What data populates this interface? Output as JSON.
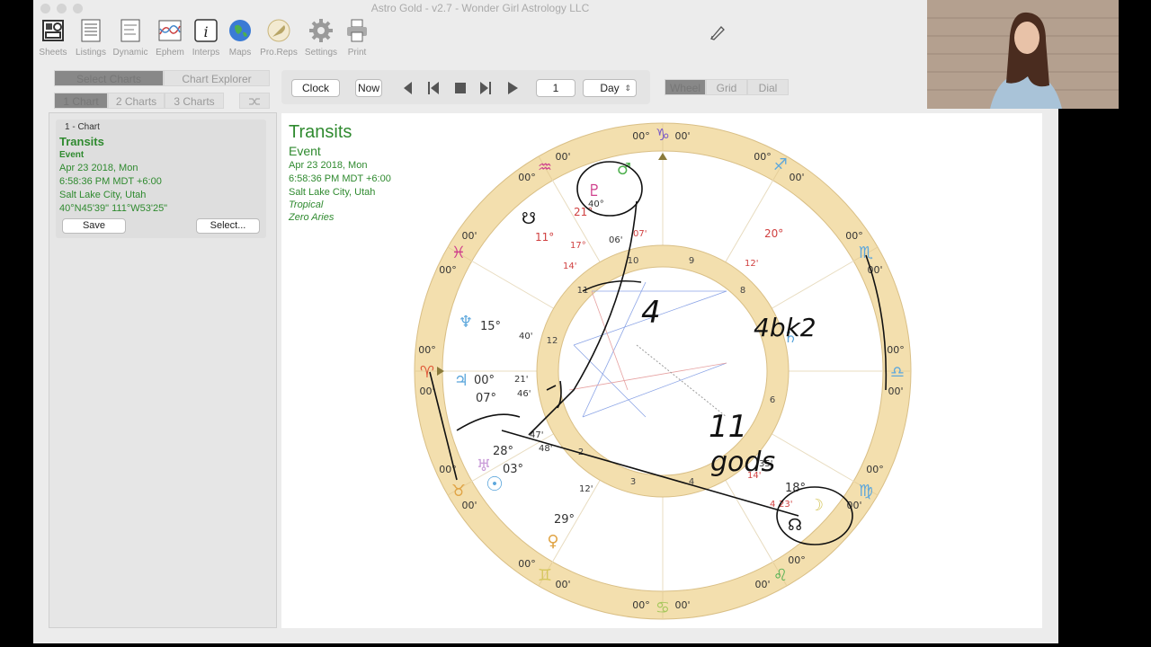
{
  "app": {
    "title": "Astro Gold - v2.7 - Wonder Girl Astrology LLC"
  },
  "toolbar": [
    {
      "label": "Sheets"
    },
    {
      "label": "Listings"
    },
    {
      "label": "Dynamic"
    },
    {
      "label": "Ephem"
    },
    {
      "label": "Interps"
    },
    {
      "label": "Maps"
    },
    {
      "label": "Pro.Reps"
    },
    {
      "label": "Settings"
    },
    {
      "label": "Print"
    }
  ],
  "chart_mode": {
    "tabs": [
      "Select Charts",
      "Chart Explorer"
    ],
    "counts": [
      "1 Chart",
      "2 Charts",
      "3 Charts"
    ]
  },
  "nav": {
    "clock": "Clock",
    "now": "Now",
    "step_value": "1",
    "step_unit": "Day"
  },
  "view_mode": {
    "tabs": [
      "Wheel",
      "Grid",
      "Dial"
    ]
  },
  "chart_card": {
    "header": "1 - Chart",
    "name": "Transits",
    "type": "Event",
    "date": "Apr 23 2018, Mon",
    "time": "6:58:36 PM MDT +6:00",
    "place": "Salt Lake City, Utah",
    "coords": "40°N45'39\" 111°W53'25\"",
    "save": "Save",
    "select": "Select..."
  },
  "chart_info": {
    "title": "Transits",
    "type": "Event",
    "date": "Apr 23 2018, Mon",
    "time": "6:58:36 PM MDT +6:00",
    "place": "Salt Lake City, Utah",
    "zodiac": "Tropical",
    "ref": "Zero Aries"
  },
  "wheel": {
    "ring_degrees": [
      "00°",
      "00'",
      "00°",
      "00'",
      "00°",
      "00'",
      "00°",
      "00'",
      "00°",
      "00'",
      "00°",
      "00'",
      "00°",
      "00'",
      "00°",
      "00'",
      "00°",
      "00'",
      "00°",
      "00'",
      "00°",
      "00'",
      "00°",
      "00'",
      "00°",
      "00'",
      "00°",
      "00'",
      "00°",
      "00'",
      "00°",
      "00'",
      "00°",
      "00'",
      "00°",
      "00'"
    ],
    "house_numbers": [
      "10",
      "9",
      "8",
      "11",
      "12",
      "6",
      "2",
      "3",
      "4"
    ],
    "planet_labels": [
      "21°",
      "40°",
      "17°",
      "06'",
      "07'",
      "11°",
      "14'",
      "15°",
      "40'",
      "00°",
      "21'",
      "07°",
      "46'",
      "47'",
      "28°",
      "48'",
      "03°",
      "12'",
      "29°",
      "20°",
      "12'",
      "35'",
      "14'",
      "18°",
      "4",
      "23'"
    ],
    "annotations": [
      "4",
      "4bk2",
      "11",
      "gods"
    ]
  },
  "colors": {
    "ring": "#f3dfae",
    "green_text": "#2f8a2f",
    "zodiac_blue": "#5da7dc"
  }
}
